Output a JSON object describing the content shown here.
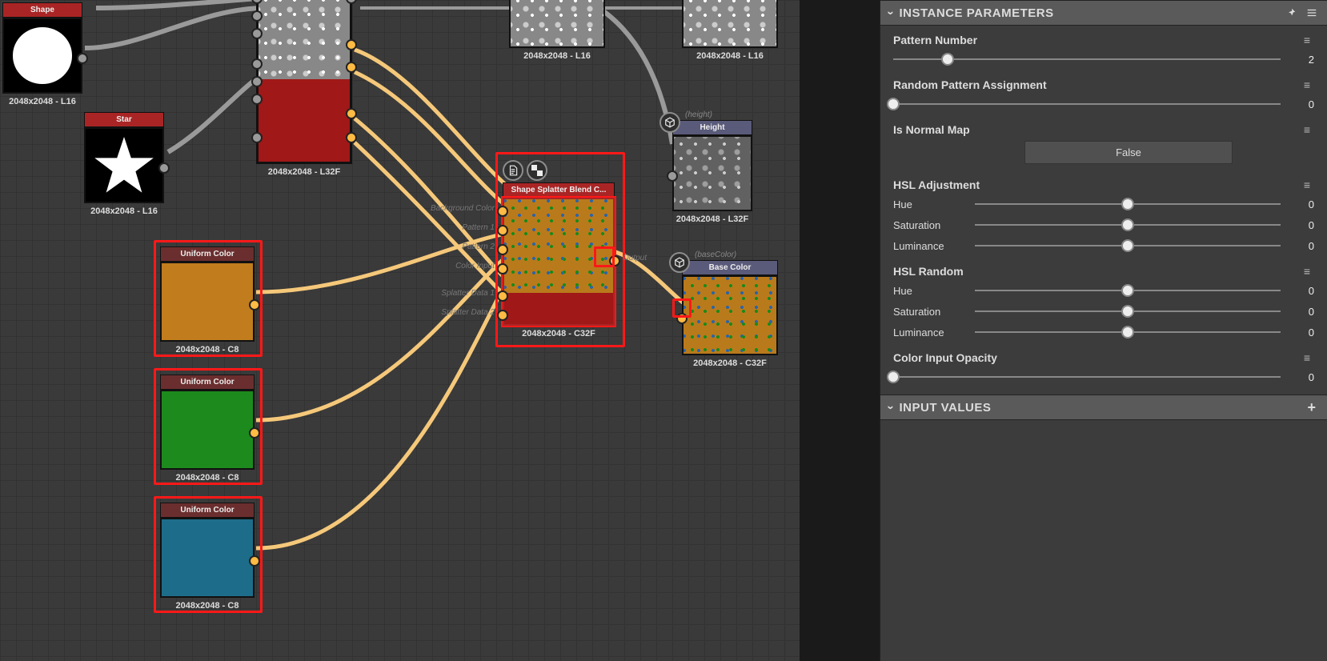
{
  "panel": {
    "sections": {
      "instance_params_title": "INSTANCE PARAMETERS",
      "input_values_title": "INPUT VALUES"
    },
    "patternNumber": {
      "label": "Pattern Number",
      "value": "2"
    },
    "randomPattern": {
      "label": "Random Pattern Assignment",
      "value": "0"
    },
    "isNormalMap": {
      "label": "Is Normal Map",
      "value": "False"
    },
    "hslAdj": {
      "title": "HSL Adjustment",
      "hueLabel": "Hue",
      "hueValue": "0",
      "satLabel": "Saturation",
      "satValue": "0",
      "lumLabel": "Luminance",
      "lumValue": "0"
    },
    "hslRnd": {
      "title": "HSL Random",
      "hueLabel": "Hue",
      "hueValue": "0",
      "satLabel": "Saturation",
      "satValue": "0",
      "lumLabel": "Luminance",
      "lumValue": "0"
    },
    "colorOpacity": {
      "label": "Color Input Opacity",
      "value": "0"
    }
  },
  "nodes": {
    "shape": {
      "title": "Shape",
      "caption": "2048x2048 - L16"
    },
    "star": {
      "title": "Star",
      "caption": "2048x2048 - L16"
    },
    "bigRed": {
      "caption": "2048x2048 - L32F"
    },
    "noiseA": {
      "caption": "2048x2048 - L16"
    },
    "noiseB": {
      "caption": "2048x2048 - L16"
    },
    "uc1": {
      "title": "Uniform Color",
      "caption": "2048x2048 - C8"
    },
    "uc2": {
      "title": "Uniform Color",
      "caption": "2048x2048 - C8"
    },
    "uc3": {
      "title": "Uniform Color",
      "caption": "2048x2048 - C8"
    },
    "splatter": {
      "title": "Shape Splatter Blend C...",
      "caption": "2048x2048 - C32F",
      "ports": {
        "bg": "Background Color",
        "p1": "Pattern 1",
        "p2": "Pattern 2",
        "ci": "Color Input",
        "sd1": "Splatter Data 1",
        "sd2": "Splatter Data 2",
        "out": "Output"
      }
    },
    "height": {
      "title": "Height",
      "badge": "(height)",
      "caption": "2048x2048 - L32F"
    },
    "baseColor": {
      "title": "Base Color",
      "badge": "(baseColor)",
      "caption": "2048x2048 - C32F"
    }
  }
}
